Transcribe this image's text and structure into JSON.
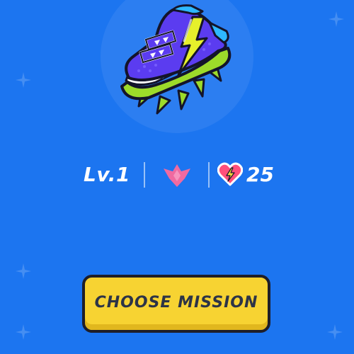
{
  "screen": {
    "background_color": "#1c75f0"
  },
  "item": {
    "icon": "running-shoe-lightning-icon",
    "colors": {
      "upper": "#5b3cf0",
      "tongue": "#2eb8ff",
      "bolt": "#e6f02b",
      "sole": "#9ddb2a",
      "outline": "#14142a"
    }
  },
  "stats": {
    "level_label": "Lv.1",
    "rank_icon": "pink-chevron-rank-icon",
    "rank_color": "#f06aa0",
    "hearts_icon": "lightning-heart-icon",
    "hearts_count": "25"
  },
  "action": {
    "label": "CHOOSE MISSION",
    "color": "#f7d332"
  },
  "decorations": {
    "icon": "plus-sparkle-icon"
  }
}
